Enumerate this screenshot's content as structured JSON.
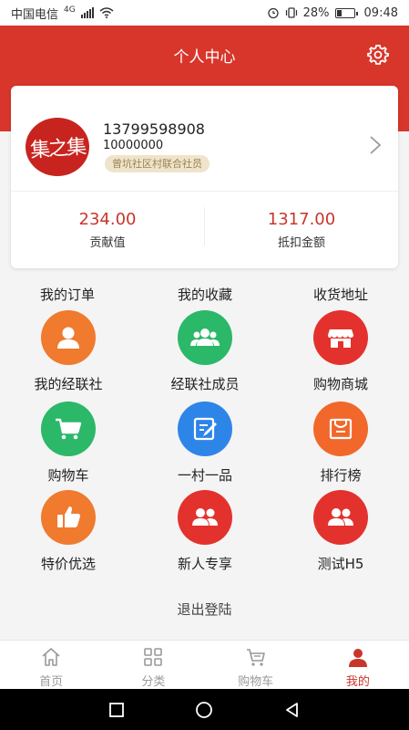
{
  "status_bar": {
    "carrier": "中国电信",
    "network": "4G",
    "battery": "28%",
    "time": "09:48"
  },
  "header": {
    "title": "个人中心",
    "settings_icon": "gear-icon"
  },
  "profile": {
    "avatar_text": "集之集",
    "phone": "13799598908",
    "user_id": "10000000",
    "badge": "曾坑社区村联合社员",
    "stats": [
      {
        "value": "234.00",
        "label": "贡献值"
      },
      {
        "value": "1317.00",
        "label": "抵扣金额"
      }
    ]
  },
  "quick_links": [
    "我的订单",
    "我的收藏",
    "收货地址"
  ],
  "grid": [
    {
      "label": "我的经联社",
      "icon": "user-icon",
      "color": "#f07a2e"
    },
    {
      "label": "经联社成员",
      "icon": "members-icon",
      "color": "#2bb868"
    },
    {
      "label": "购物商城",
      "icon": "store-icon",
      "color": "#e3322e"
    },
    {
      "label": "购物车",
      "icon": "cart-icon",
      "color": "#2bb868"
    },
    {
      "label": "一村一品",
      "icon": "edit-icon",
      "color": "#2e85e8"
    },
    {
      "label": "排行榜",
      "icon": "ranking-icon",
      "color": "#f2672a"
    },
    {
      "label": "特价优选",
      "icon": "thumbs-up-icon",
      "color": "#f07a2e"
    },
    {
      "label": "新人专享",
      "icon": "users-icon",
      "color": "#e3322e"
    },
    {
      "label": "测试H5",
      "icon": "users-icon",
      "color": "#e3322e"
    }
  ],
  "logout_label": "退出登陆",
  "tabs": [
    {
      "label": "首页",
      "icon": "home-icon"
    },
    {
      "label": "分类",
      "icon": "grid-icon"
    },
    {
      "label": "购物车",
      "icon": "cart-icon"
    },
    {
      "label": "我的",
      "icon": "profile-icon",
      "active": true
    }
  ],
  "colors": {
    "brand": "#d8362b",
    "stat_value": "#c8362b",
    "badge_bg": "#efe4cb",
    "badge_text": "#9b8353"
  }
}
